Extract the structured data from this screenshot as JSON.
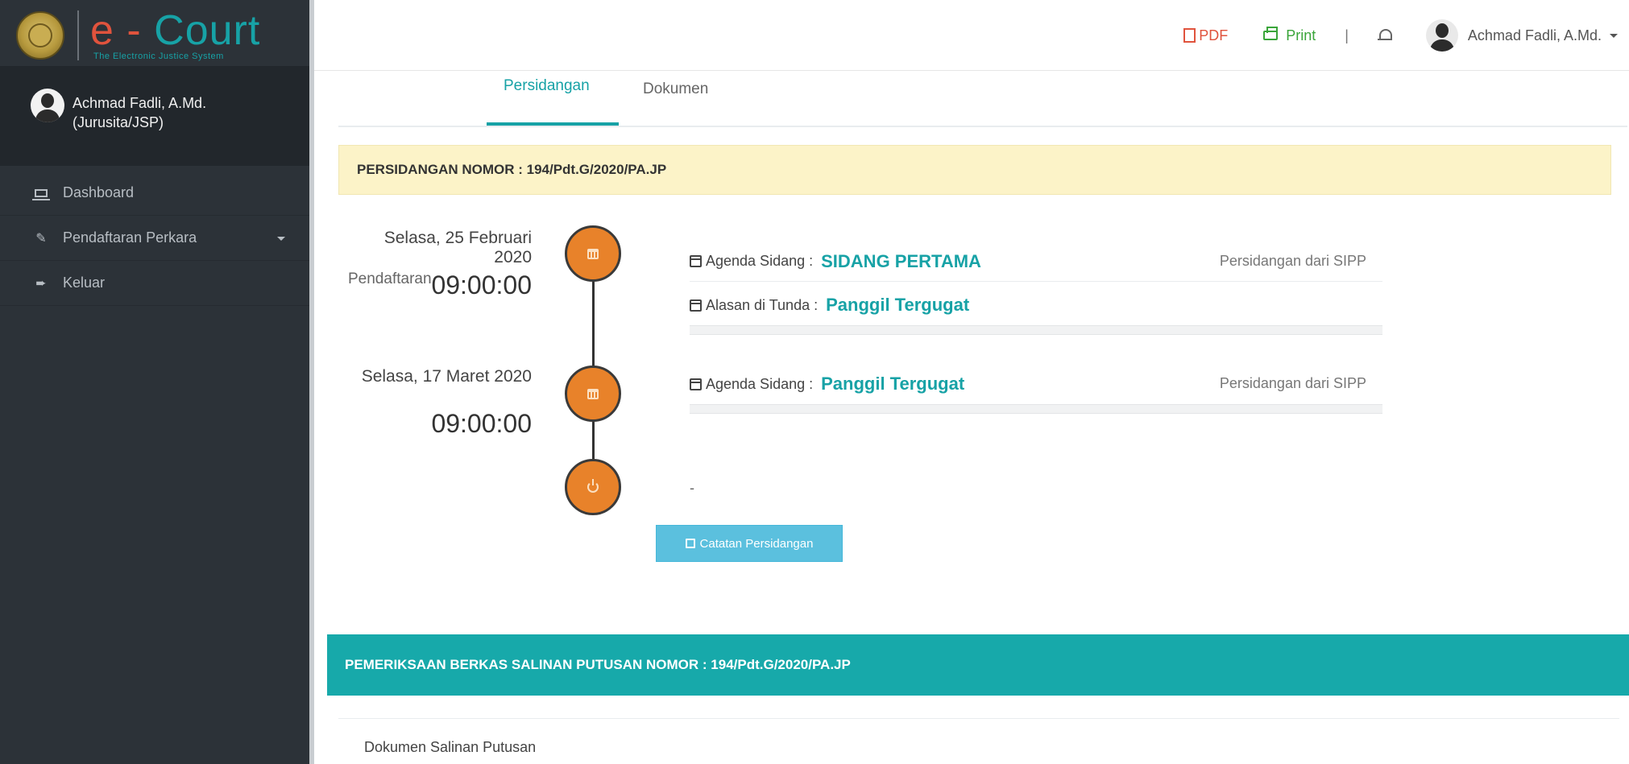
{
  "app": {
    "logo_e": "e",
    "logo_dash": "-",
    "logo_court": "Court",
    "logo_subtitle": "The Electronic Justice System"
  },
  "sidebar": {
    "user_name": "Achmad Fadli, A.Md.",
    "user_role": "(Jurusita/JSP)",
    "items": [
      {
        "label": "Dashboard",
        "icon": "laptop-icon"
      },
      {
        "label": "Pendaftaran Perkara",
        "icon": "edit-icon",
        "has_caret": true
      },
      {
        "label": "Keluar",
        "icon": "sign-out-icon"
      }
    ]
  },
  "topbar": {
    "pdf_label": "PDF",
    "print_label": "Print",
    "separator": "|",
    "user_name": "Achmad Fadli, A.Md."
  },
  "tabs": [
    {
      "label": "Pendaftaran",
      "active": false
    },
    {
      "label": "Persidangan",
      "active": true
    },
    {
      "label": "Dokumen",
      "active": false
    }
  ],
  "persidangan": {
    "heading": "PERSIDANGAN NOMOR : 194/Pdt.G/2020/PA.JP",
    "sessions": [
      {
        "date": "Selasa, 25 Februari 2020",
        "time": "09:00:00",
        "agenda_label": "Agenda Sidang :",
        "agenda_value": "SIDANG PERTAMA",
        "source": "Persidangan dari SIPP",
        "reason_label": "Alasan di Tunda :",
        "reason_value": "Panggil Tergugat"
      },
      {
        "date": "Selasa, 17 Maret 2020",
        "time": "09:00:00",
        "agenda_label": "Agenda Sidang :",
        "agenda_value": "Panggil Tergugat",
        "source": "Persidangan dari SIPP"
      }
    ],
    "end_marker": "-",
    "catatan_button": "Catatan Persidangan"
  },
  "pemeriksaan": {
    "heading": "PEMERIKSAAN BERKAS SALINAN PUTUSAN NOMOR : 194/Pdt.G/2020/PA.JP",
    "doc_label": "Dokumen Salinan Putusan"
  },
  "colors": {
    "accent_teal": "#17a2a6",
    "timeline_orange": "#e8822a",
    "sidebar_bg": "#2c3238",
    "warning_bg": "#fcf3c8",
    "info_button": "#5bc0de"
  }
}
